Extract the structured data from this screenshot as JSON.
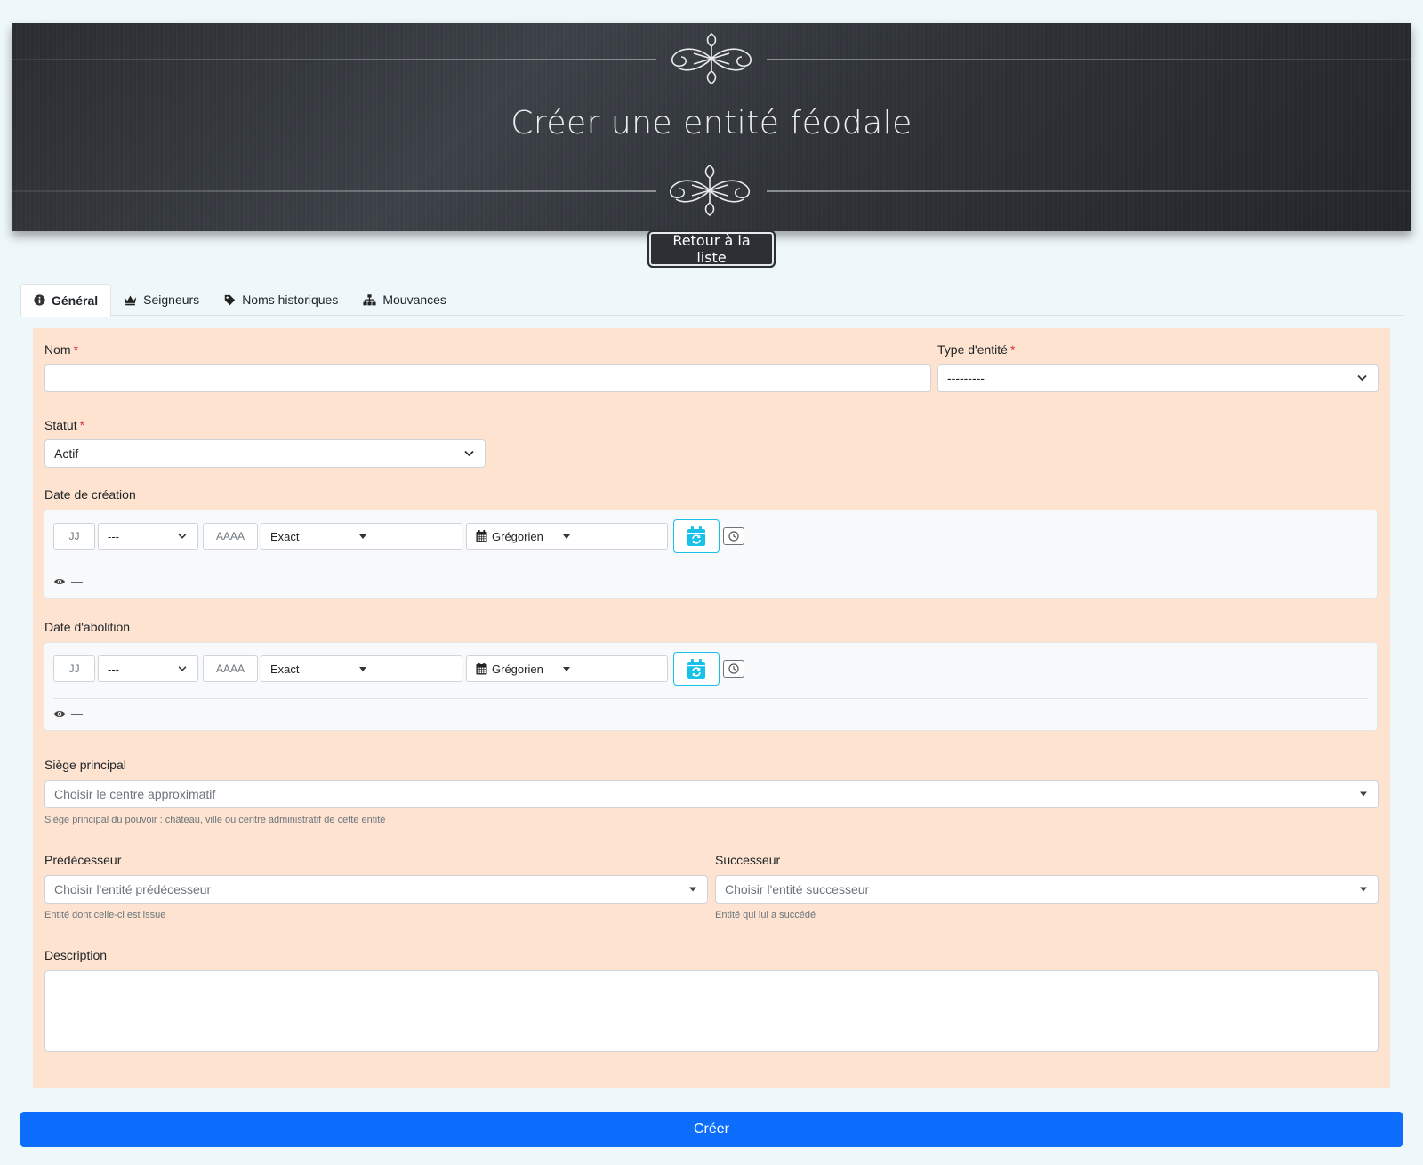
{
  "header": {
    "title": "Créer une entité féodale",
    "back_label": "Retour à la liste"
  },
  "tabs": [
    {
      "label": "Général",
      "icon": "info-circle-icon",
      "active": true
    },
    {
      "label": "Seigneurs",
      "icon": "crown-icon",
      "active": false
    },
    {
      "label": "Noms historiques",
      "icon": "tag-icon",
      "active": false
    },
    {
      "label": "Mouvances",
      "icon": "sitemap-icon",
      "active": false
    }
  ],
  "form": {
    "nom": {
      "label": "Nom",
      "required_mark": "*",
      "value": ""
    },
    "type": {
      "label": "Type d'entité",
      "required_mark": "*",
      "value": "---------"
    },
    "statut": {
      "label": "Statut",
      "required_mark": "*",
      "value": "Actif"
    },
    "date_creation": {
      "label": "Date de création",
      "day_placeholder": "JJ",
      "month_value": "---",
      "year_placeholder": "AAAA",
      "precision": "Exact",
      "calendar": "Grégorien",
      "preview": "—"
    },
    "date_abolition": {
      "label": "Date d'abolition",
      "day_placeholder": "JJ",
      "month_value": "---",
      "year_placeholder": "AAAA",
      "precision": "Exact",
      "calendar": "Grégorien",
      "preview": "—"
    },
    "siege": {
      "label": "Siège principal",
      "placeholder": "Choisir le centre approximatif",
      "help": "Siège principal du pouvoir : château, ville ou centre administratif de cette entité"
    },
    "predecesseur": {
      "label": "Prédécesseur",
      "placeholder": "Choisir l'entité prédécesseur",
      "help": "Entité dont celle-ci est issue"
    },
    "successeur": {
      "label": "Successeur",
      "placeholder": "Choisir l'entité successeur",
      "help": "Entité qui lui a succédé"
    },
    "description": {
      "label": "Description",
      "value": ""
    }
  },
  "submit_label": "Créer",
  "colors": {
    "page_bg": "#eef7fa",
    "panel_bg": "#fde3d0",
    "primary": "#0d6efd",
    "calendar_accent": "#17c1e8",
    "required": "#dc3545"
  }
}
